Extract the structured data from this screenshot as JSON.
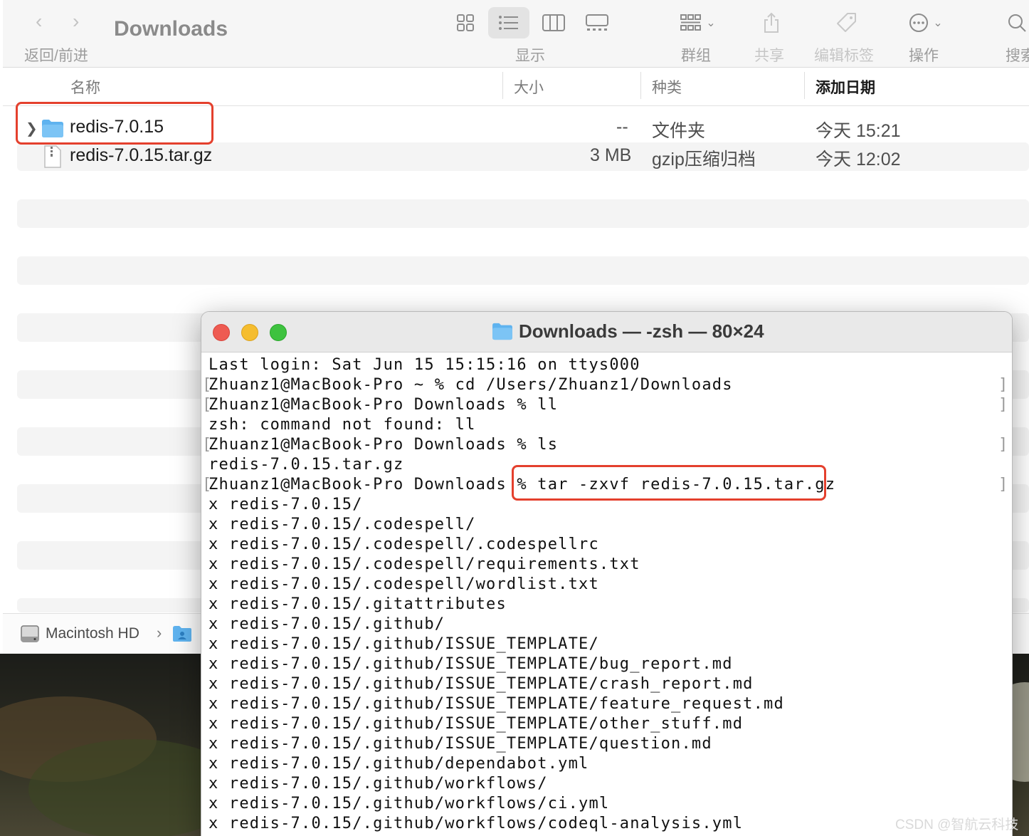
{
  "finder": {
    "title": "Downloads",
    "toolbar": {
      "back_forward_label": "返回/前进",
      "view_label": "显示",
      "group_label": "群组",
      "share_label": "共享",
      "tags_label": "编辑标签",
      "action_label": "操作",
      "search_label": "搜索"
    },
    "columns": {
      "name": "名称",
      "size": "大小",
      "kind": "种类",
      "date_added": "添加日期"
    },
    "files": [
      {
        "name": "redis-7.0.15",
        "size": "--",
        "kind": "文件夹",
        "date_added": "今天 15:21",
        "icon": "folder-icon",
        "expandable": true
      },
      {
        "name": "redis-7.0.15.tar.gz",
        "size": "3 MB",
        "kind": "gzip压缩归档",
        "date_added": "今天 12:02",
        "icon": "archive-file-icon",
        "expandable": false
      }
    ],
    "path_bar": {
      "volume": "Macintosh HD"
    }
  },
  "terminal": {
    "title": "Downloads — -zsh — 80×24",
    "lines": [
      {
        "text": "Last login: Sat Jun 15 15:15:16 on ttys000",
        "prompt": false
      },
      {
        "text": "Zhuanz1@MacBook-Pro ~ % cd /Users/Zhuanz1/Downloads",
        "prompt": true
      },
      {
        "text": "Zhuanz1@MacBook-Pro Downloads % ll",
        "prompt": true
      },
      {
        "text": "zsh: command not found: ll",
        "prompt": false
      },
      {
        "text": "Zhuanz1@MacBook-Pro Downloads % ls",
        "prompt": true
      },
      {
        "text": "redis-7.0.15.tar.gz",
        "prompt": false
      },
      {
        "text": "Zhuanz1@MacBook-Pro Downloads % tar -zxvf redis-7.0.15.tar.gz",
        "prompt": true
      },
      {
        "text": "x redis-7.0.15/",
        "prompt": false
      },
      {
        "text": "x redis-7.0.15/.codespell/",
        "prompt": false
      },
      {
        "text": "x redis-7.0.15/.codespell/.codespellrc",
        "prompt": false
      },
      {
        "text": "x redis-7.0.15/.codespell/requirements.txt",
        "prompt": false
      },
      {
        "text": "x redis-7.0.15/.codespell/wordlist.txt",
        "prompt": false
      },
      {
        "text": "x redis-7.0.15/.gitattributes",
        "prompt": false
      },
      {
        "text": "x redis-7.0.15/.github/",
        "prompt": false
      },
      {
        "text": "x redis-7.0.15/.github/ISSUE_TEMPLATE/",
        "prompt": false
      },
      {
        "text": "x redis-7.0.15/.github/ISSUE_TEMPLATE/bug_report.md",
        "prompt": false
      },
      {
        "text": "x redis-7.0.15/.github/ISSUE_TEMPLATE/crash_report.md",
        "prompt": false
      },
      {
        "text": "x redis-7.0.15/.github/ISSUE_TEMPLATE/feature_request.md",
        "prompt": false
      },
      {
        "text": "x redis-7.0.15/.github/ISSUE_TEMPLATE/other_stuff.md",
        "prompt": false
      },
      {
        "text": "x redis-7.0.15/.github/ISSUE_TEMPLATE/question.md",
        "prompt": false
      },
      {
        "text": "x redis-7.0.15/.github/dependabot.yml",
        "prompt": false
      },
      {
        "text": "x redis-7.0.15/.github/workflows/",
        "prompt": false
      },
      {
        "text": "x redis-7.0.15/.github/workflows/ci.yml",
        "prompt": false
      },
      {
        "text": "x redis-7.0.15/.github/workflows/codeql-analysis.yml",
        "prompt": false
      }
    ]
  },
  "watermark": "CSDN @智航云科技",
  "colors": {
    "highlight_box": "#e4402d",
    "folder_blue": "#5fb3ef",
    "traffic_red": "#ee5b52",
    "traffic_yellow": "#f5bd2f",
    "traffic_green": "#3ec23f"
  }
}
